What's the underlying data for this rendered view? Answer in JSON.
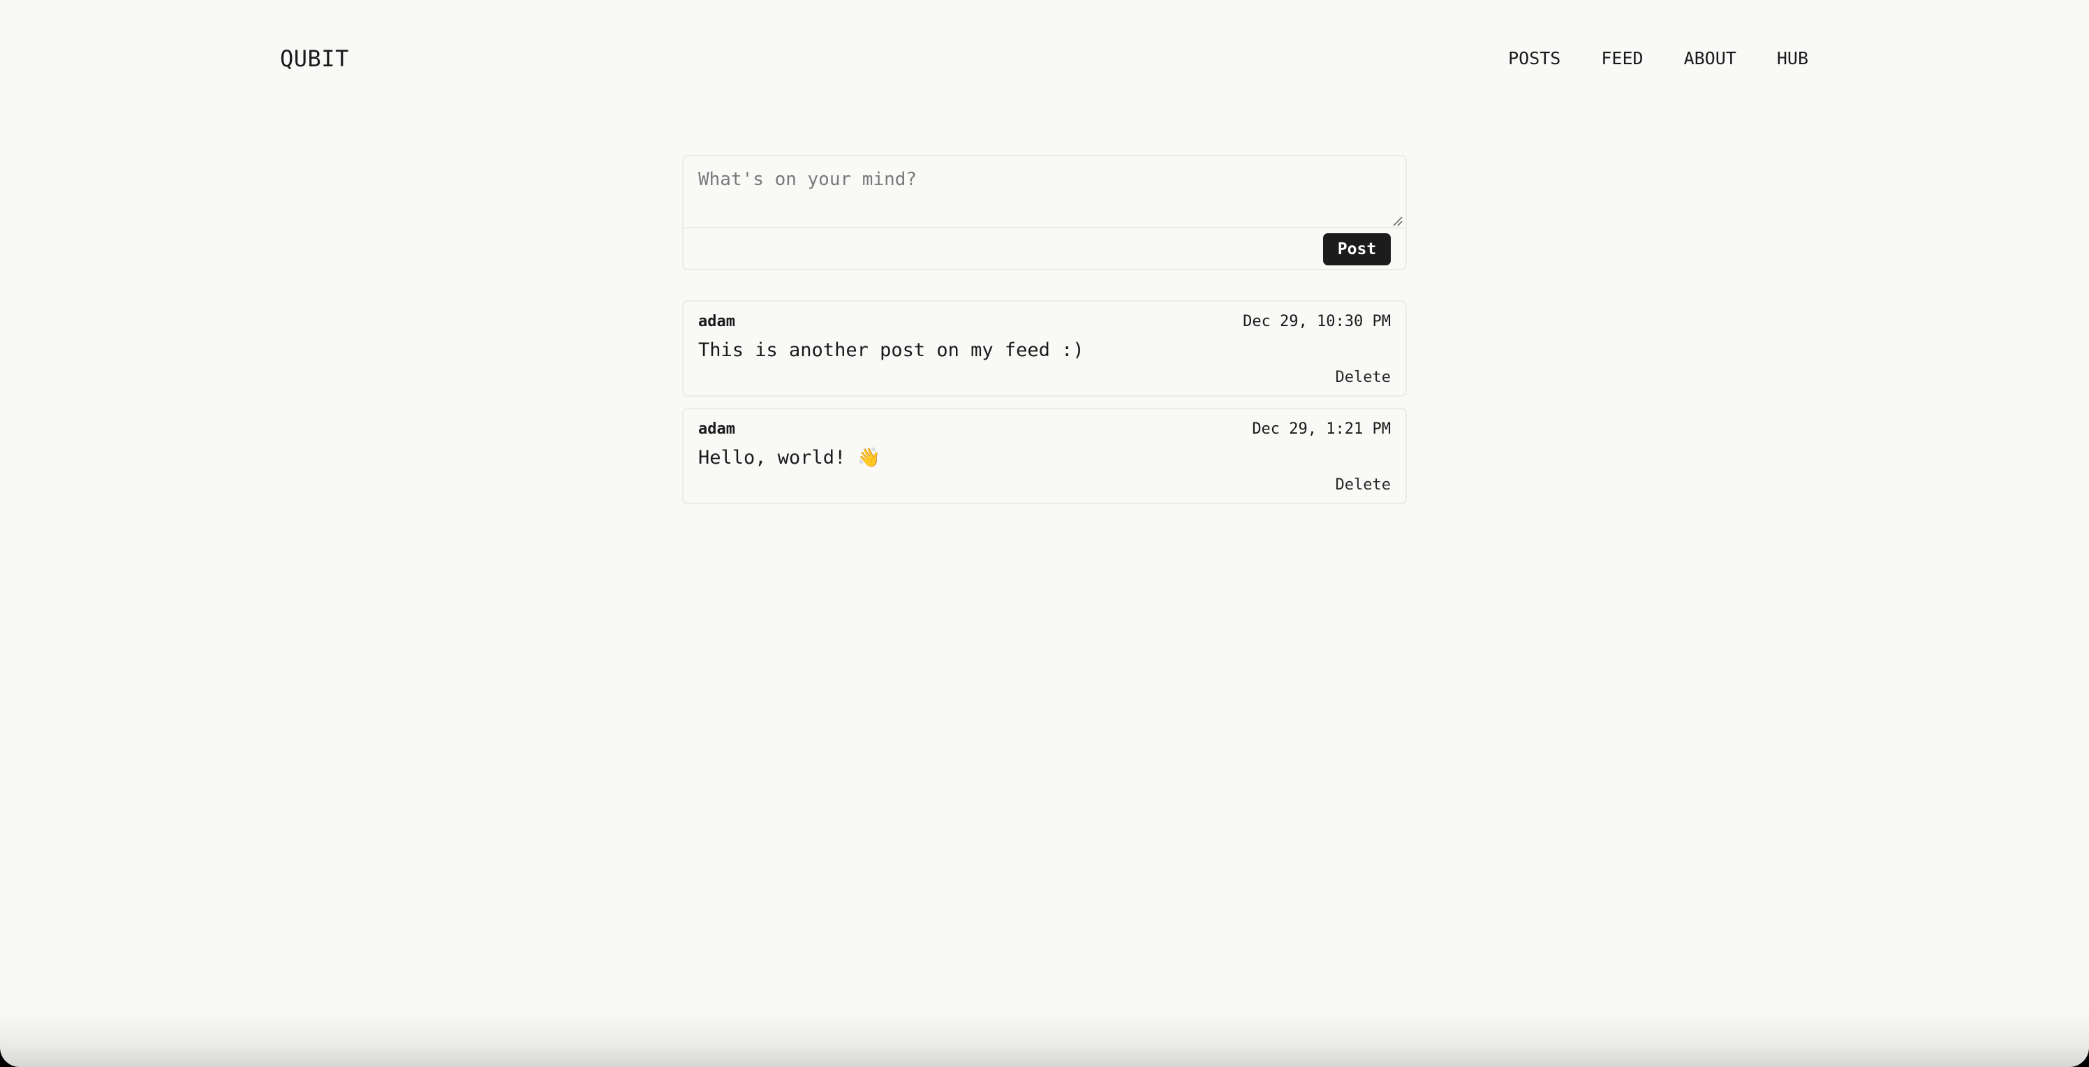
{
  "header": {
    "logo": "QUBIT",
    "nav": [
      {
        "label": "POSTS"
      },
      {
        "label": "FEED"
      },
      {
        "label": "ABOUT"
      },
      {
        "label": "HUB"
      }
    ]
  },
  "composer": {
    "placeholder": "What's on your mind?",
    "value": "",
    "submit_label": "Post"
  },
  "posts": [
    {
      "author": "adam",
      "time": "Dec 29, 10:30 PM",
      "body": "This is another post on my feed :)",
      "delete_label": "Delete"
    },
    {
      "author": "adam",
      "time": "Dec 29, 1:21 PM",
      "body": "Hello, world! 👋",
      "delete_label": "Delete"
    }
  ]
}
